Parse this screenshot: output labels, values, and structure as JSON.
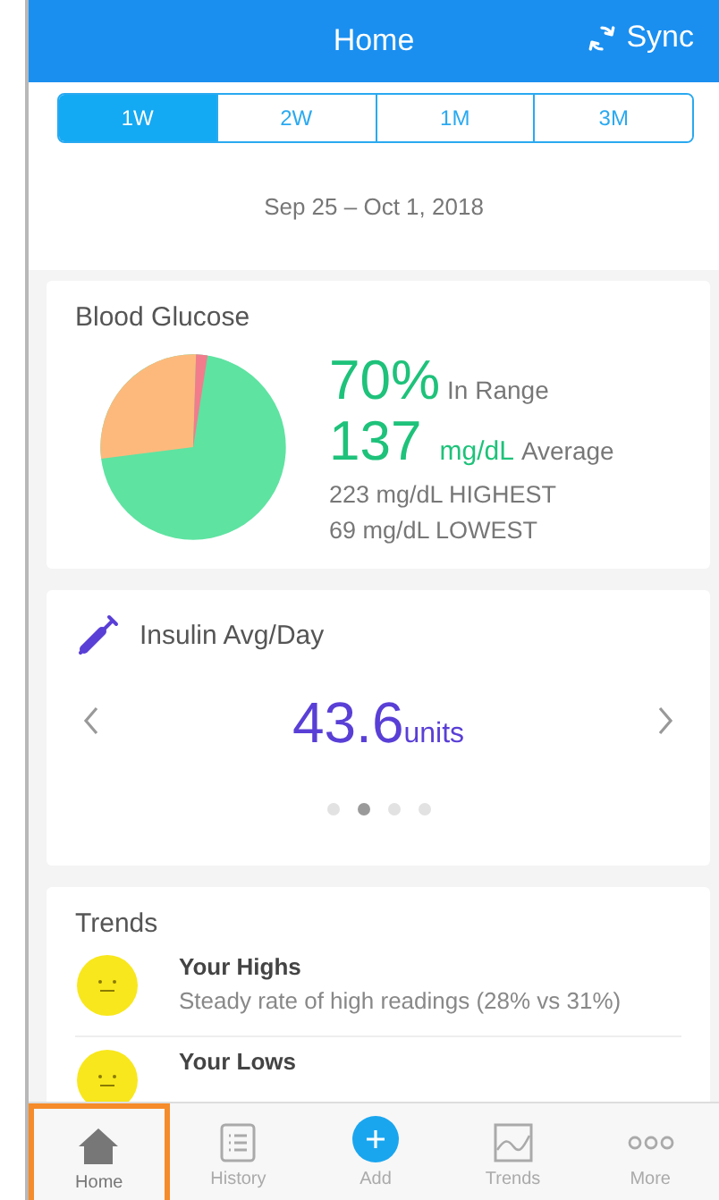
{
  "header": {
    "title": "Home",
    "sync": "Sync"
  },
  "ranges": [
    {
      "label": "1W",
      "selected": true
    },
    {
      "label": "2W",
      "selected": false
    },
    {
      "label": "1M",
      "selected": false
    },
    {
      "label": "3M",
      "selected": false
    }
  ],
  "date_range": "Sep 25 – Oct 1, 2018",
  "glucose": {
    "title": "Blood Glucose",
    "in_range": "70%",
    "in_range_label": "In Range",
    "average": "137",
    "unit": "mg/dL",
    "average_label": "Average",
    "highest": "223 mg/dL HIGHEST",
    "lowest": "69 mg/dL LOWEST"
  },
  "insulin": {
    "title": "Insulin Avg/Day",
    "value": "43.6",
    "unit": "units",
    "dots": [
      {
        "selected": false
      },
      {
        "selected": true
      },
      {
        "selected": false
      },
      {
        "selected": false
      }
    ]
  },
  "trends": {
    "title": "Trends",
    "items": [
      {
        "title": "Your Highs",
        "text": "Steady rate of high readings (28% vs 31%)"
      },
      {
        "title": "Your Lows"
      }
    ]
  },
  "tab_bar": [
    {
      "label": "Home",
      "selected": true,
      "highlighted": true
    },
    {
      "label": "History",
      "selected": false,
      "highlighted": false
    },
    {
      "label": "Add",
      "selected": false,
      "highlighted": false
    },
    {
      "label": "Trends",
      "selected": false,
      "highlighted": false
    },
    {
      "label": "More",
      "selected": false,
      "highlighted": false
    }
  ]
}
